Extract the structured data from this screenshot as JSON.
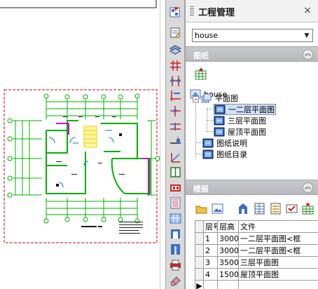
{
  "panel": {
    "title": "工程管理",
    "close_glyph": "×",
    "project": {
      "selected": "house"
    },
    "drawings_section": {
      "title": "图纸",
      "tree": {
        "root": "house",
        "plan_group": "平面图",
        "plans": [
          "一二层平面图",
          "三层平面图",
          "屋顶平面图"
        ],
        "docs": [
          "图纸说明",
          "图纸目录"
        ]
      }
    },
    "floors_section": {
      "title": "楼层",
      "table": {
        "columns": [
          "层号",
          "层高",
          "文件"
        ],
        "rows": [
          {
            "floor": "1",
            "height": "3000",
            "file": "一二层平面图<框"
          },
          {
            "floor": "2",
            "height": "3000",
            "file": "一二层平面图<框"
          },
          {
            "floor": "3",
            "height": "3500",
            "file": "三层平面图"
          },
          {
            "floor": "4",
            "height": "1500",
            "file": "屋顶平面图"
          }
        ]
      }
    }
  },
  "toolbar_icons": [
    "new-project-icon",
    "edit-note-icon",
    "layers-icon",
    "axis-grid-icon",
    "column-icon",
    "wall-icon",
    "door-icon",
    "window-icon",
    "stair-icon",
    "elevator-icon",
    "room-icon",
    "frame-icon",
    "materials-icon",
    "section-icon",
    "elevation-icon",
    "detail-icon",
    "print-icon",
    "eraser-icon"
  ],
  "floor_toolbar_icons": [
    "open-folder-icon",
    "image-icon",
    "building-icon",
    "table-icon",
    "list-icon",
    "check-icon",
    "add-floor-icon"
  ],
  "colors": {
    "accent_drawing": "#00c800",
    "frame_red": "#cc0000",
    "panel_header": "#b9bbc0",
    "selection": "#cfe0f7"
  }
}
